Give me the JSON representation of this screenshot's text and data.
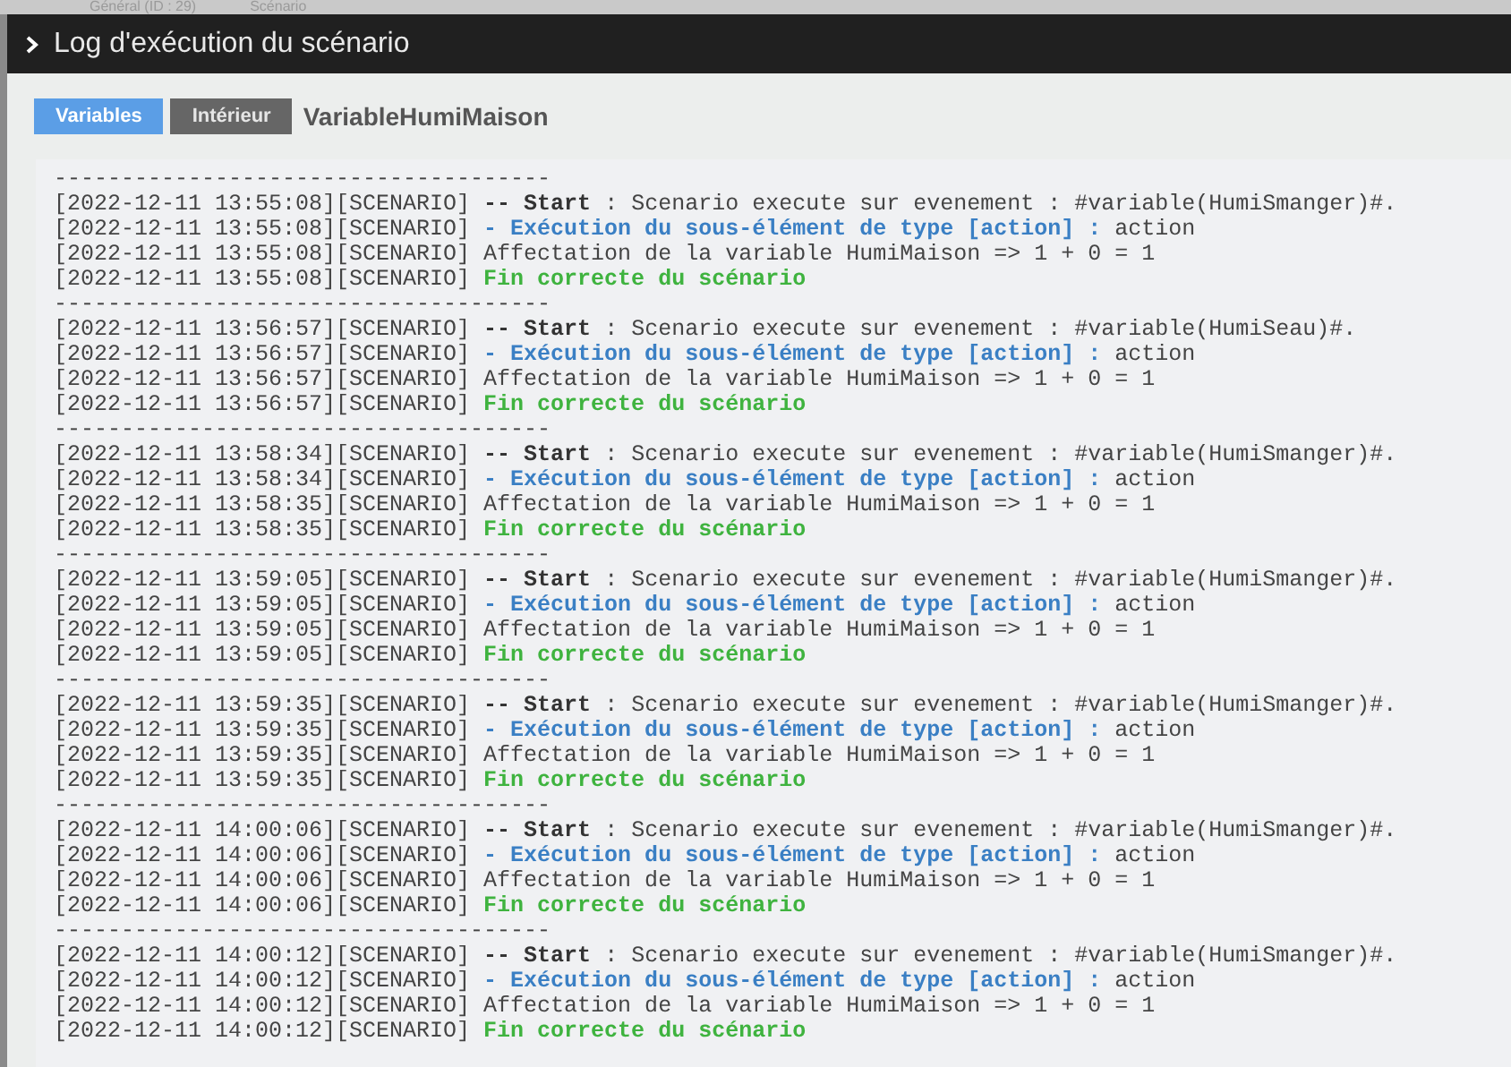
{
  "background_tabs": [
    {
      "label": "Général (ID : 29)"
    },
    {
      "label": "Scénario"
    }
  ],
  "window": {
    "title": "Log d'exécution du scénario"
  },
  "tags": [
    {
      "label": "Variables",
      "kind": "category"
    },
    {
      "label": "Intérieur",
      "kind": "object"
    }
  ],
  "scenario_name": "VariableHumiMaison",
  "log": {
    "lines": [
      {
        "kind": "separator",
        "text": "-------------------------------------"
      },
      {
        "kind": "start",
        "prefix": "[2022-12-11 13:55:08][SCENARIO]",
        "label": "-- Start",
        "text": " : Scenario execute sur evenement : #variable(HumiSmanger)#."
      },
      {
        "kind": "step",
        "prefix": "[2022-12-11 13:55:08][SCENARIO]",
        "label": "- Exécution du sous-élément de type [action] :",
        "text": " action"
      },
      {
        "kind": "info",
        "prefix": "[2022-12-11 13:55:08][SCENARIO]",
        "text": "Affectation de la variable HumiMaison => 1 + 0 = 1"
      },
      {
        "kind": "end",
        "prefix": "[2022-12-11 13:55:08][SCENARIO]",
        "label": "Fin correcte du scénario"
      },
      {
        "kind": "separator",
        "text": "-------------------------------------"
      },
      {
        "kind": "start",
        "prefix": "[2022-12-11 13:56:57][SCENARIO]",
        "label": "-- Start",
        "text": " : Scenario execute sur evenement : #variable(HumiSeau)#."
      },
      {
        "kind": "step",
        "prefix": "[2022-12-11 13:56:57][SCENARIO]",
        "label": "- Exécution du sous-élément de type [action] :",
        "text": " action"
      },
      {
        "kind": "info",
        "prefix": "[2022-12-11 13:56:57][SCENARIO]",
        "text": "Affectation de la variable HumiMaison => 1 + 0 = 1"
      },
      {
        "kind": "end",
        "prefix": "[2022-12-11 13:56:57][SCENARIO]",
        "label": "Fin correcte du scénario"
      },
      {
        "kind": "separator",
        "text": "-------------------------------------"
      },
      {
        "kind": "start",
        "prefix": "[2022-12-11 13:58:34][SCENARIO]",
        "label": "-- Start",
        "text": " : Scenario execute sur evenement : #variable(HumiSmanger)#."
      },
      {
        "kind": "step",
        "prefix": "[2022-12-11 13:58:34][SCENARIO]",
        "label": "- Exécution du sous-élément de type [action] :",
        "text": " action"
      },
      {
        "kind": "info",
        "prefix": "[2022-12-11 13:58:35][SCENARIO]",
        "text": "Affectation de la variable HumiMaison => 1 + 0 = 1"
      },
      {
        "kind": "end",
        "prefix": "[2022-12-11 13:58:35][SCENARIO]",
        "label": "Fin correcte du scénario"
      },
      {
        "kind": "separator",
        "text": "-------------------------------------"
      },
      {
        "kind": "start",
        "prefix": "[2022-12-11 13:59:05][SCENARIO]",
        "label": "-- Start",
        "text": " : Scenario execute sur evenement : #variable(HumiSmanger)#."
      },
      {
        "kind": "step",
        "prefix": "[2022-12-11 13:59:05][SCENARIO]",
        "label": "- Exécution du sous-élément de type [action] :",
        "text": " action"
      },
      {
        "kind": "info",
        "prefix": "[2022-12-11 13:59:05][SCENARIO]",
        "text": "Affectation de la variable HumiMaison => 1 + 0 = 1"
      },
      {
        "kind": "end",
        "prefix": "[2022-12-11 13:59:05][SCENARIO]",
        "label": "Fin correcte du scénario"
      },
      {
        "kind": "separator",
        "text": "-------------------------------------"
      },
      {
        "kind": "start",
        "prefix": "[2022-12-11 13:59:35][SCENARIO]",
        "label": "-- Start",
        "text": " : Scenario execute sur evenement : #variable(HumiSmanger)#."
      },
      {
        "kind": "step",
        "prefix": "[2022-12-11 13:59:35][SCENARIO]",
        "label": "- Exécution du sous-élément de type [action] :",
        "text": " action"
      },
      {
        "kind": "info",
        "prefix": "[2022-12-11 13:59:35][SCENARIO]",
        "text": "Affectation de la variable HumiMaison => 1 + 0 = 1"
      },
      {
        "kind": "end",
        "prefix": "[2022-12-11 13:59:35][SCENARIO]",
        "label": "Fin correcte du scénario"
      },
      {
        "kind": "separator",
        "text": "-------------------------------------"
      },
      {
        "kind": "start",
        "prefix": "[2022-12-11 14:00:06][SCENARIO]",
        "label": "-- Start",
        "text": " : Scenario execute sur evenement : #variable(HumiSmanger)#."
      },
      {
        "kind": "step",
        "prefix": "[2022-12-11 14:00:06][SCENARIO]",
        "label": "- Exécution du sous-élément de type [action] :",
        "text": " action"
      },
      {
        "kind": "info",
        "prefix": "[2022-12-11 14:00:06][SCENARIO]",
        "text": "Affectation de la variable HumiMaison => 1 + 0 = 1"
      },
      {
        "kind": "end",
        "prefix": "[2022-12-11 14:00:06][SCENARIO]",
        "label": "Fin correcte du scénario"
      },
      {
        "kind": "separator",
        "text": "-------------------------------------"
      },
      {
        "kind": "start",
        "prefix": "[2022-12-11 14:00:12][SCENARIO]",
        "label": "-- Start",
        "text": " : Scenario execute sur evenement : #variable(HumiSmanger)#."
      },
      {
        "kind": "step",
        "prefix": "[2022-12-11 14:00:12][SCENARIO]",
        "label": "- Exécution du sous-élément de type [action] :",
        "text": " action"
      },
      {
        "kind": "info",
        "prefix": "[2022-12-11 14:00:12][SCENARIO]",
        "text": "Affectation de la variable HumiMaison => 1 + 0 = 1"
      },
      {
        "kind": "end",
        "prefix": "[2022-12-11 14:00:12][SCENARIO]",
        "label": "Fin correcte du scénario"
      }
    ]
  }
}
